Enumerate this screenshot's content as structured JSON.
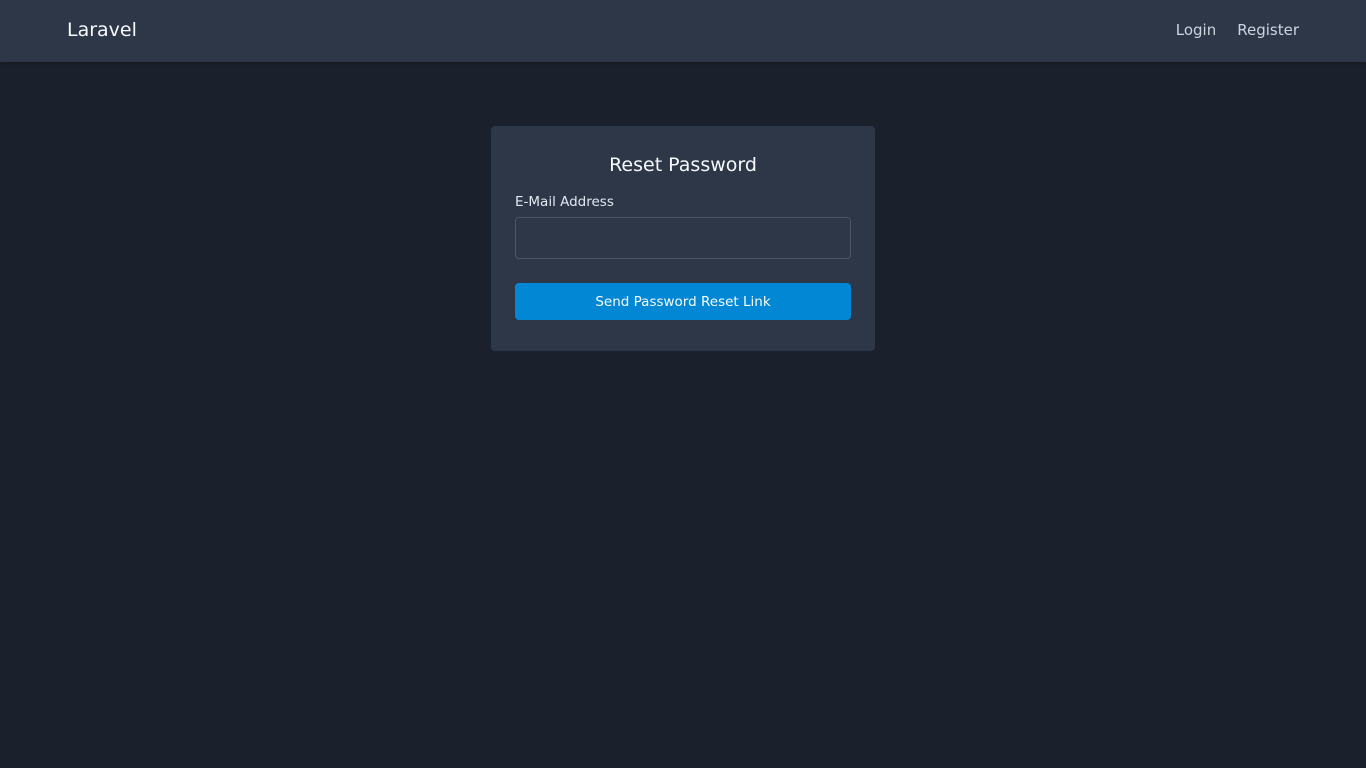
{
  "navbar": {
    "brand": "Laravel",
    "links": [
      {
        "label": "Login"
      },
      {
        "label": "Register"
      }
    ]
  },
  "reset_card": {
    "title": "Reset Password",
    "email_label": "E-Mail Address",
    "email_value": "",
    "submit_label": "Send Password Reset Link"
  },
  "colors": {
    "page_background": "#1a202c",
    "navbar_background": "#2d3748",
    "card_background": "#2d3748",
    "primary_button": "#0287d4",
    "input_border": "#4a5568"
  }
}
